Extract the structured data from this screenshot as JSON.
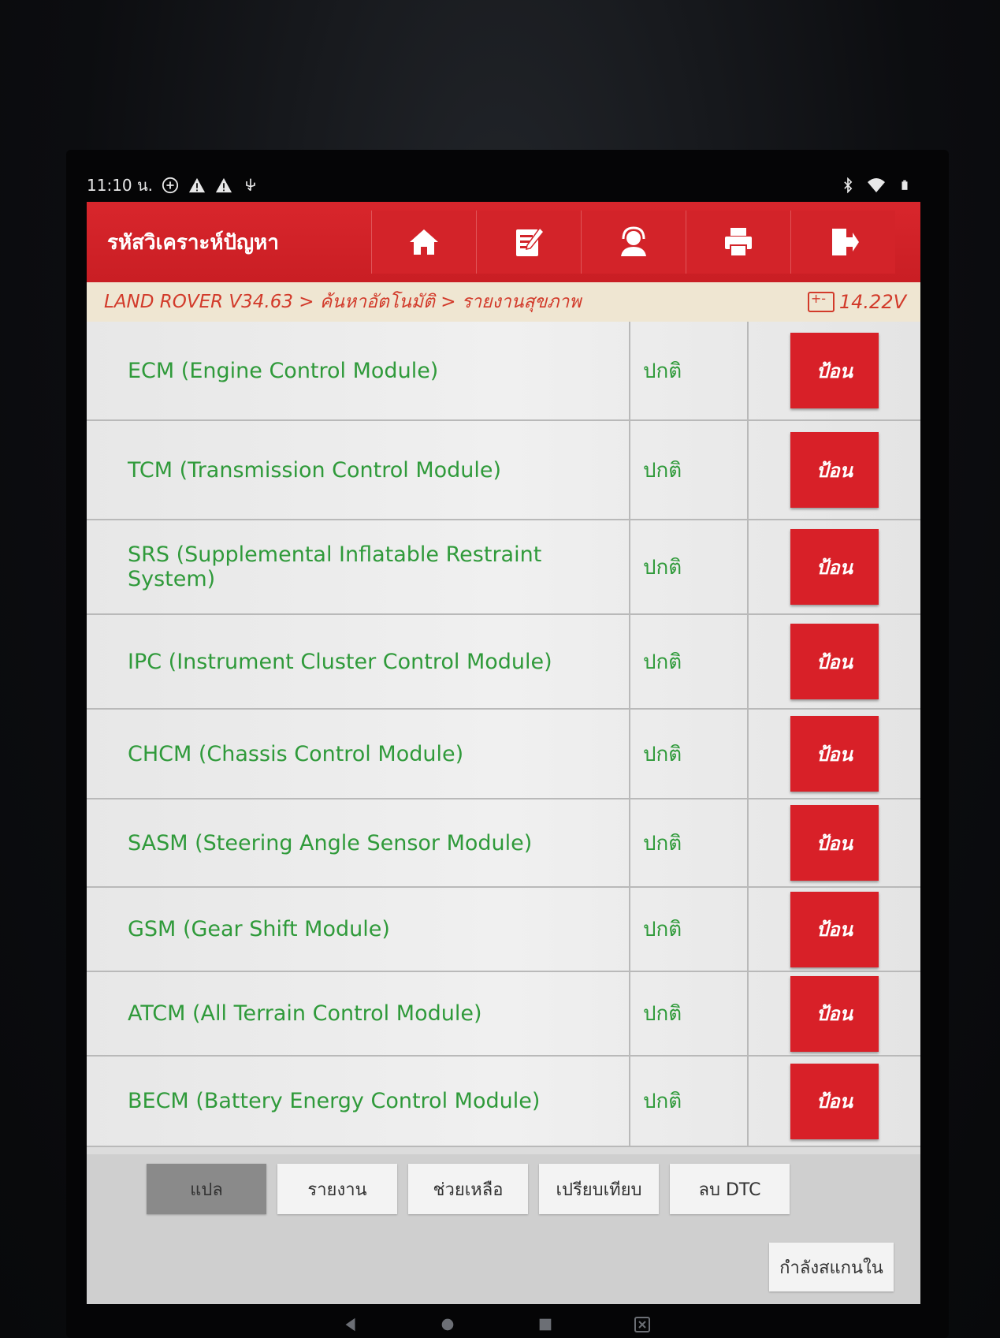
{
  "status_bar": {
    "time": "11:10 น."
  },
  "header": {
    "title": "รหัสวิเคราะห์ปัญหา",
    "toolbar": [
      {
        "icon": "home-icon"
      },
      {
        "icon": "edit-icon"
      },
      {
        "icon": "support-icon"
      },
      {
        "icon": "print-icon"
      },
      {
        "icon": "exit-icon"
      }
    ]
  },
  "breadcrumb": {
    "path": "LAND ROVER V34.63 > ค้นหาอัตโนมัติ > รายงานสุขภาพ",
    "voltage": "14.22V"
  },
  "modules": [
    {
      "name": "ECM (Engine Control Module)",
      "status": "ปกติ",
      "button": "ป้อน"
    },
    {
      "name": "TCM (Transmission Control Module)",
      "status": "ปกติ",
      "button": "ป้อน"
    },
    {
      "name": "SRS (Supplemental Inflatable Restraint System)",
      "status": "ปกติ",
      "button": "ป้อน"
    },
    {
      "name": "IPC (Instrument Cluster Control Module)",
      "status": "ปกติ",
      "button": "ป้อน"
    },
    {
      "name": "CHCM (Chassis Control Module)",
      "status": "ปกติ",
      "button": "ป้อน"
    },
    {
      "name": "SASM (Steering Angle Sensor Module)",
      "status": "ปกติ",
      "button": "ป้อน"
    },
    {
      "name": "GSM (Gear Shift Module)",
      "status": "ปกติ",
      "button": "ป้อน"
    },
    {
      "name": "ATCM (All Terrain Control Module)",
      "status": "ปกติ",
      "button": "ป้อน"
    },
    {
      "name": "BECM (Battery Energy Control Module)",
      "status": "ปกติ",
      "button": "ป้อน"
    }
  ],
  "bottom_tabs": [
    "แปล",
    "รายงาน",
    "ช่วยเหลือ",
    "เปรียบเทียบ",
    "ลบ DTC"
  ],
  "scan_button": "กำลังสแกนใน",
  "colors": {
    "header_red": "#d32329",
    "module_text_green": "#2f9a3a",
    "breadcrumb_red": "#d23a2a"
  }
}
